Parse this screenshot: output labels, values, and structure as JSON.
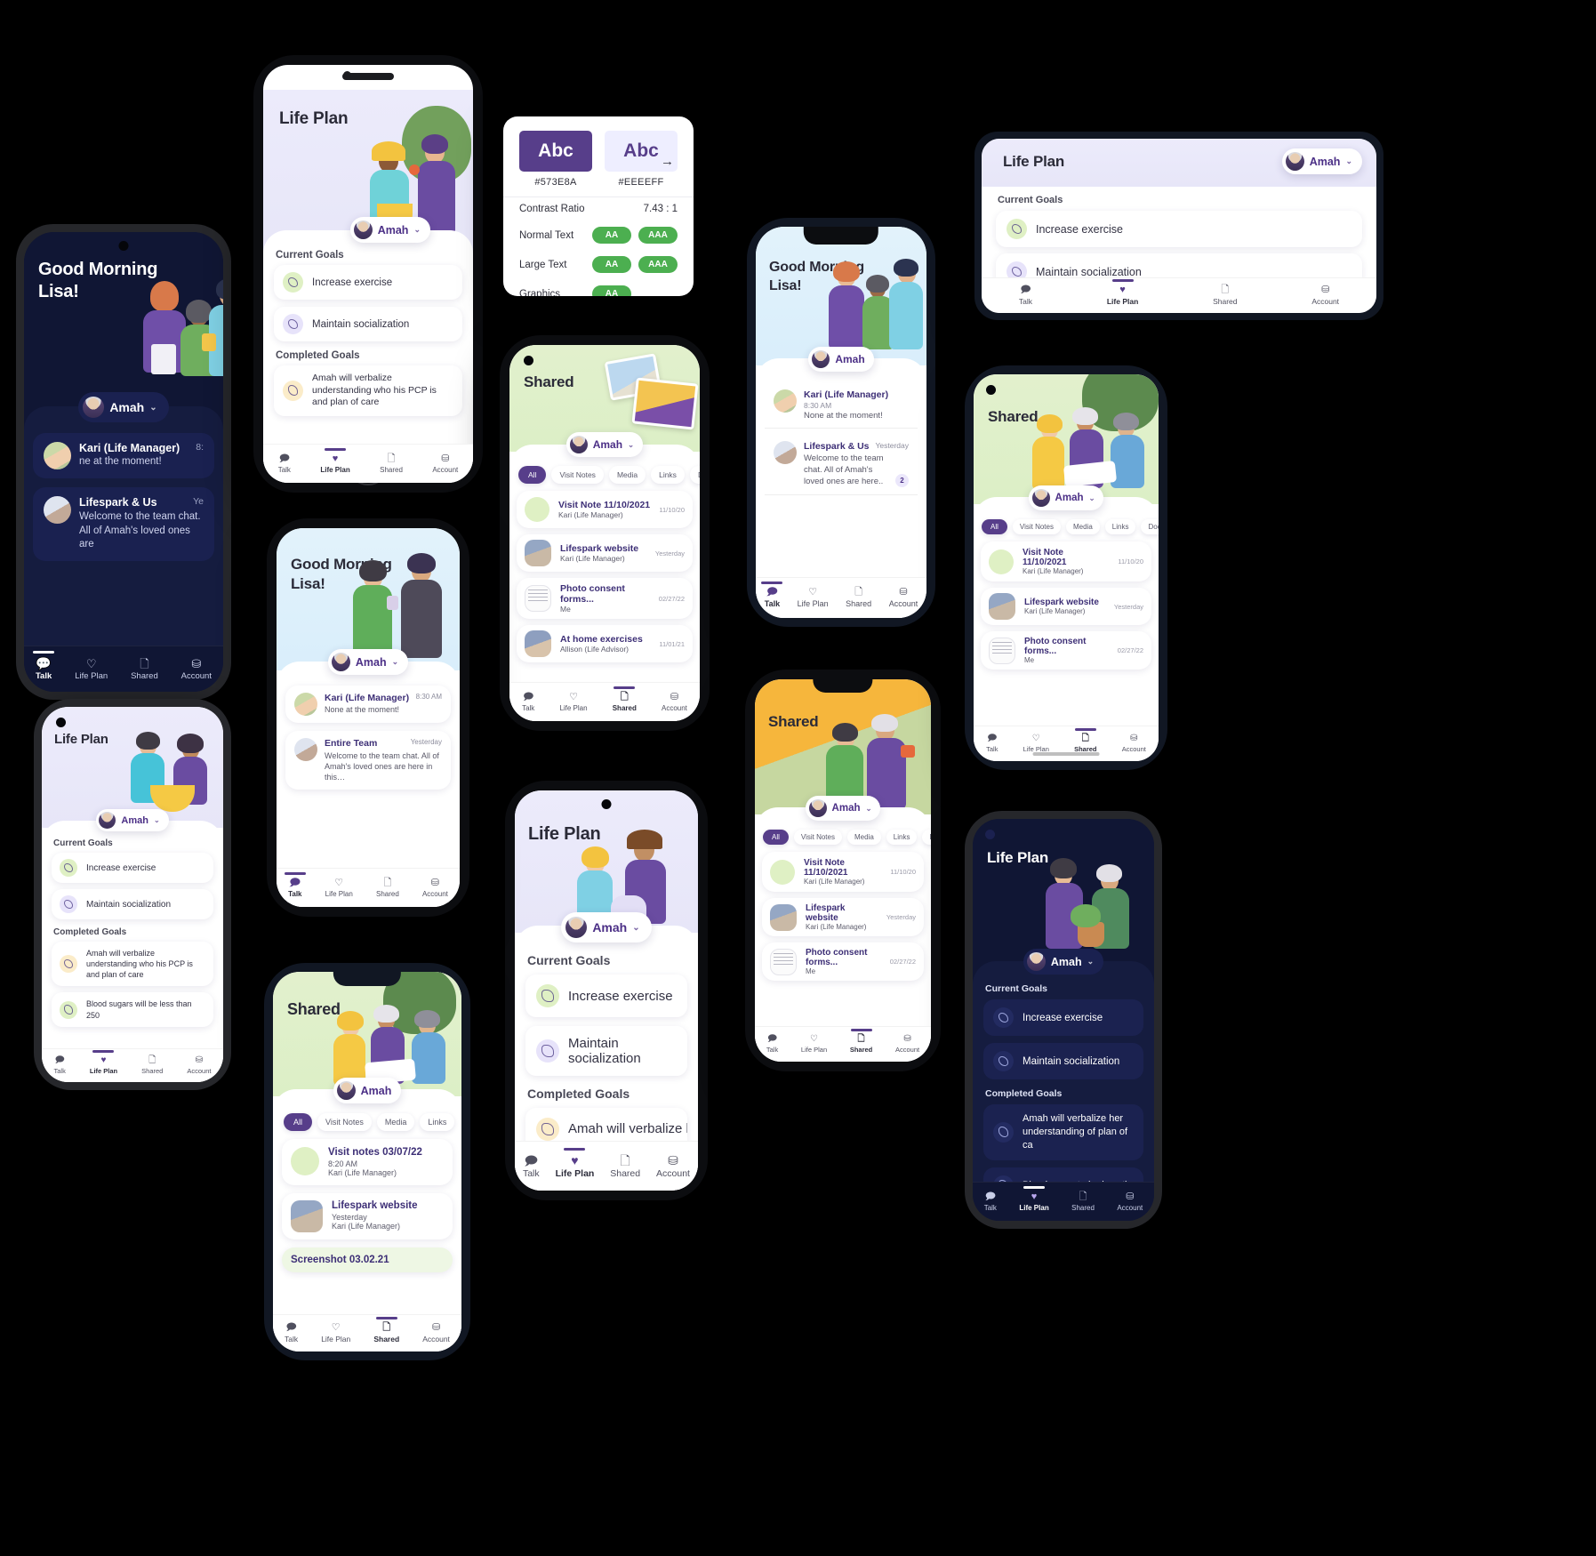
{
  "brand": {
    "purple": "#573E8A",
    "lavender": "#EEEEFF",
    "navy": "#101634",
    "cyan": "#5BC8E0",
    "green_pass": "#4CAF50"
  },
  "nav": {
    "items": [
      {
        "label": "Talk",
        "icon": "chat-bubble-icon"
      },
      {
        "label": "Life Plan",
        "icon": "heart-icon"
      },
      {
        "label": "Shared",
        "icon": "document-icon"
      },
      {
        "label": "Account",
        "icon": "person-icon"
      }
    ]
  },
  "user_chip": {
    "name": "Amah",
    "caret": "⌄"
  },
  "contrast_panel": {
    "foreground": {
      "sample": "Abc",
      "hex": "#573E8A"
    },
    "background": {
      "sample": "Abc",
      "hex": "#EEEEFF"
    },
    "swap_icon": "arrow-right-icon",
    "rows": [
      {
        "label": "Contrast Ratio",
        "value": "7.43 : 1",
        "badges": []
      },
      {
        "label": "Normal Text",
        "value": "",
        "badges": [
          "AA",
          "AAA"
        ]
      },
      {
        "label": "Large Text",
        "value": "",
        "badges": [
          "AA",
          "AAA"
        ]
      },
      {
        "label": "Graphics",
        "value": "",
        "badges": [
          "AA"
        ]
      }
    ]
  },
  "screens": {
    "talk_dark": {
      "greeting_line1": "Good Morning",
      "greeting_line2": "Lisa!",
      "chats": [
        {
          "name": "Kari (Life Manager)",
          "time": "8:",
          "preview": "ne at the moment!"
        },
        {
          "name": "Lifespark & Us",
          "time": "Ye",
          "preview": "Welcome to the team chat. All of Amah's loved ones are"
        }
      ],
      "active_tab": "Talk"
    },
    "talk_light_tall": {
      "greeting_line1": "Good Morning",
      "greeting_line2": "Lisa!",
      "chats": [
        {
          "name": "Kari (Life Manager)",
          "time": "8:30 AM",
          "preview": "None at the moment!"
        },
        {
          "name": "Entire Team",
          "time": "Yesterday",
          "preview": "Welcome to the team chat. All of Amah's loved ones are here in this…"
        }
      ],
      "active_tab": "Talk"
    },
    "talk_notch": {
      "greeting_line1": "Good Morning",
      "greeting_line2": "Lisa!",
      "chats": [
        {
          "name": "Kari (Life Manager)",
          "time": "8:30 AM",
          "preview": "None at the moment!"
        },
        {
          "name": "Lifespark & Us",
          "time": "Yesterday",
          "preview": "Welcome to the team chat. All of Amah's loved ones are here..",
          "badge": "2"
        }
      ],
      "active_tab": "Talk"
    },
    "lifeplan_light_top": {
      "title": "Life Plan",
      "current_label": "Current Goals",
      "current_goals": [
        "Increase exercise",
        "Maintain socialization"
      ],
      "completed_label": "Completed Goals",
      "completed_goals": [
        "Amah will verbalize understanding who his PCP is and plan of care"
      ],
      "active_tab": "Life Plan"
    },
    "lifeplan_light_left": {
      "title": "Life Plan",
      "current_label": "Current Goals",
      "current_goals": [
        "Increase exercise",
        "Maintain socialization"
      ],
      "completed_label": "Completed Goals",
      "completed_goals": [
        "Amah will verbalize understanding who his PCP is and plan of care",
        "Blood sugars will be less than 250"
      ],
      "active_tab": "Life Plan"
    },
    "lifeplan_large": {
      "title": "Life Plan",
      "current_label": "Current Goals",
      "current_goals": [
        "Increase exercise",
        "Maintain socialization"
      ],
      "completed_label": "Completed Goals",
      "completed_goals": [
        "Amah will verbalize her understanding of plan"
      ],
      "active_tab": "Life Plan"
    },
    "lifeplan_tablet": {
      "title": "Life Plan",
      "current_label": "Current Goals",
      "current_goals": [
        "Increase exercise",
        "Maintain socialization"
      ],
      "active_tab": "Life Plan"
    },
    "lifeplan_dark": {
      "title": "Life Plan",
      "current_label": "Current Goals",
      "current_goals": [
        "Increase exercise",
        "Maintain socialization"
      ],
      "completed_label": "Completed Goals",
      "completed_goals": [
        "Amah will verbalize her understanding of plan of ca",
        "Blood sugar to be less than"
      ],
      "active_tab": "Life Plan"
    },
    "shared_small": {
      "title": "Shared",
      "filters": [
        "All",
        "Visit Notes",
        "Media",
        "Links",
        "Documents"
      ],
      "active_filter": "All",
      "rows": [
        {
          "title": "Visit Note 11/10/2021",
          "sub": "Kari (Life Manager)",
          "date": "11/10/20",
          "thumb": "home-visit-icon"
        },
        {
          "title": "Lifespark website",
          "sub": "Kari (Life Manager)",
          "date": "Yesterday",
          "thumb": "photo-thumb"
        },
        {
          "title": "Photo consent forms...",
          "sub": "Me",
          "date": "02/27/22",
          "thumb": "document-thumb"
        },
        {
          "title": "At home exercises",
          "sub": "Allison (Life Advisor)",
          "date": "11/01/21",
          "thumb": "photo-thumb"
        }
      ],
      "active_tab": "Shared"
    },
    "shared_bottom_left": {
      "title": "Shared",
      "filters": [
        "All",
        "Visit Notes",
        "Media",
        "Links"
      ],
      "active_filter": "All",
      "rows": [
        {
          "title": "Visit notes 03/07/22",
          "sub2": "8:20 AM",
          "sub": "Kari (Life Manager)",
          "thumb": "home-visit-icon"
        },
        {
          "title": "Lifespark website",
          "sub2": "Yesterday",
          "sub": "Kari (Life Manager)",
          "thumb": "photo-thumb"
        },
        {
          "title": "Screenshot 03.02.21",
          "sub2": "",
          "sub": "",
          "thumb": "photo-thumb"
        }
      ],
      "active_tab": "Shared"
    },
    "shared_right": {
      "title": "Shared",
      "filters": [
        "All",
        "Visit Notes",
        "Media",
        "Links",
        "Documents"
      ],
      "active_filter": "All",
      "rows": [
        {
          "title": "Visit Note 11/10/2021",
          "sub": "Kari (Life Manager)",
          "date": "11/10/20",
          "thumb": "home-visit-icon"
        },
        {
          "title": "Lifespark website",
          "sub": "Kari (Life Manager)",
          "date": "Yesterday",
          "thumb": "photo-thumb"
        },
        {
          "title": "Photo consent forms...",
          "sub": "Me",
          "date": "02/27/22",
          "thumb": "document-thumb"
        }
      ],
      "active_tab": "Shared"
    },
    "shared_orange": {
      "title": "Shared",
      "filters": [
        "All",
        "Visit Notes",
        "Media",
        "Links",
        "Documents"
      ],
      "active_filter": "All",
      "rows": [
        {
          "title": "Visit Note 11/10/2021",
          "sub": "Kari (Life Manager)",
          "date": "11/10/20",
          "thumb": "home-visit-icon"
        },
        {
          "title": "Lifespark website",
          "sub": "Kari (Life Manager)",
          "date": "Yesterday",
          "thumb": "photo-thumb"
        },
        {
          "title": "Photo consent forms...",
          "sub": "Me",
          "date": "02/27/22",
          "thumb": "document-thumb"
        }
      ],
      "active_tab": "Shared"
    }
  }
}
